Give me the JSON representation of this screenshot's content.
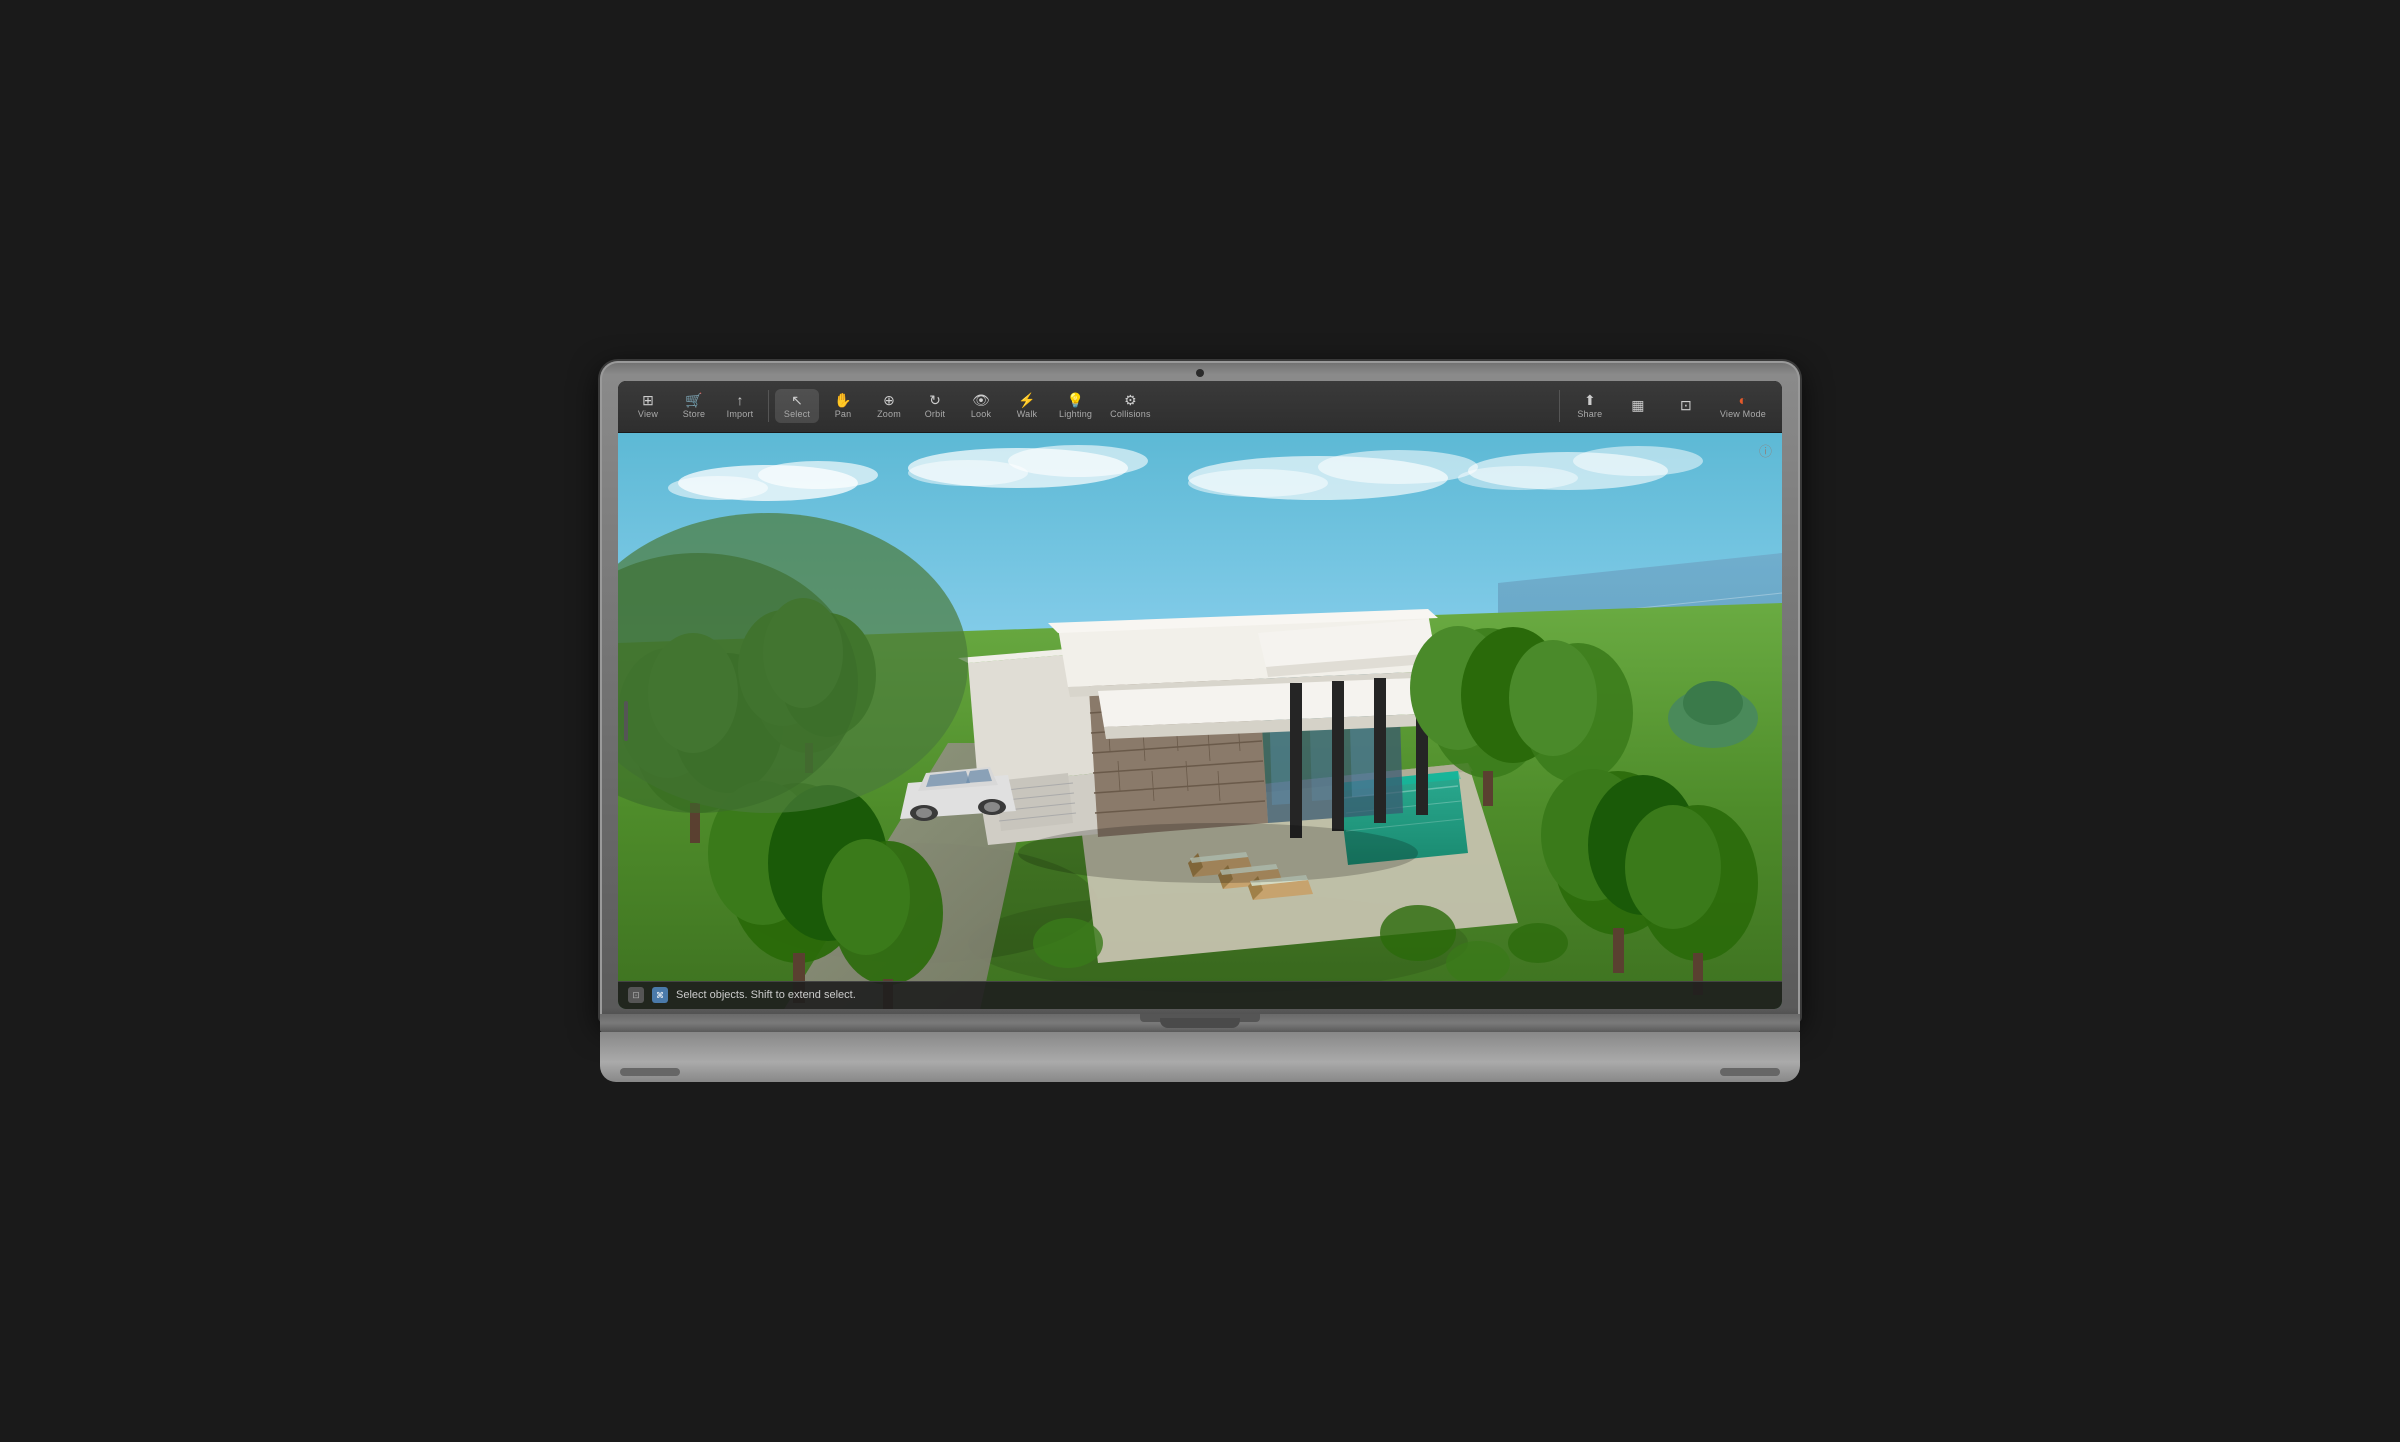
{
  "toolbar": {
    "tools": [
      {
        "id": "view",
        "label": "View",
        "icon": "⊞",
        "color": "#aaa"
      },
      {
        "id": "store",
        "label": "Store",
        "icon": "🛒",
        "color": "#aaa"
      },
      {
        "id": "import",
        "label": "Import",
        "icon": "📥",
        "color": "#aaa"
      },
      {
        "id": "select",
        "label": "Select",
        "icon": "↖",
        "color": "#aaa",
        "active": true
      },
      {
        "id": "pan",
        "label": "Pan",
        "icon": "✋",
        "color": "#aaa"
      },
      {
        "id": "zoom",
        "label": "Zoom",
        "icon": "🔍",
        "color": "#aaa"
      },
      {
        "id": "orbit",
        "label": "Orbit",
        "icon": "⊙",
        "color": "#aaa"
      },
      {
        "id": "look",
        "label": "Look",
        "icon": "👁",
        "color": "#aaa"
      },
      {
        "id": "walk",
        "label": "Walk",
        "icon": "⚡",
        "color": "#aaa"
      },
      {
        "id": "lighting",
        "label": "Lighting",
        "icon": "💡",
        "color": "#f5c542"
      },
      {
        "id": "collisions",
        "label": "Collisions",
        "icon": "⚙",
        "color": "#aaa"
      }
    ],
    "right_tools": [
      {
        "id": "share",
        "label": "Share",
        "icon": "⬆",
        "color": "#aaa"
      },
      {
        "id": "floor_plan",
        "label": "",
        "icon": "▦",
        "color": "#aaa"
      },
      {
        "id": "views",
        "label": "",
        "icon": "⊡",
        "color": "#aaa"
      },
      {
        "id": "view_mode",
        "label": "View Mode",
        "icon": "◐",
        "color": "#e55a2b"
      }
    ]
  },
  "status_bar": {
    "mode_icon": "⊡",
    "shortcut": "⌘",
    "message": "Select objects. Shift to extend select."
  },
  "info_icon": "ⓘ",
  "scene": {
    "description": "3D architectural visualization of modern house with pool"
  }
}
